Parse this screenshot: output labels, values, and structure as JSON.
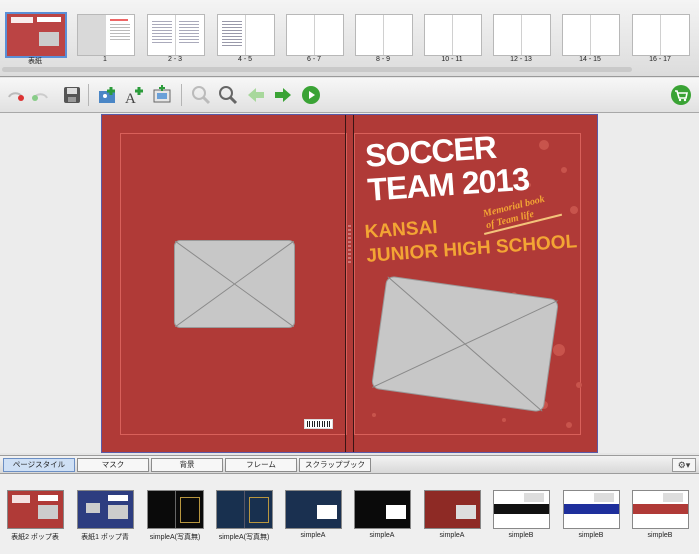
{
  "page_strip": {
    "thumbnails": [
      {
        "label": "表紙"
      },
      {
        "label": "1"
      },
      {
        "label": "2 - 3"
      },
      {
        "label": "4 - 5"
      },
      {
        "label": "6 - 7"
      },
      {
        "label": "8 - 9"
      },
      {
        "label": "10 - 11"
      },
      {
        "label": "12 - 13"
      },
      {
        "label": "14 - 15"
      },
      {
        "label": "16 - 17"
      }
    ],
    "selected_index": 0
  },
  "toolbar": {
    "icons": [
      "undo-icon",
      "redo-icon",
      "save-icon",
      "add-photo-icon",
      "add-text-icon",
      "add-frame-icon",
      "zoom-out-icon",
      "zoom-in-icon",
      "back-arrow-icon",
      "forward-arrow-icon",
      "play-icon",
      "cart-icon"
    ]
  },
  "cover": {
    "title_line1": "SOCCER",
    "title_line2": "TEAM 2013",
    "school_line1": "KANSAI",
    "school_line2": "JUNIOR HIGH SCHOOL",
    "subtitle_line1": "Memorial book",
    "subtitle_line2": "of Team life",
    "colors": {
      "cover": "#b03a37",
      "title": "#ffffff",
      "accent": "#f3a534"
    }
  },
  "tabs": [
    {
      "label": "ページスタイル",
      "active": true
    },
    {
      "label": "マスク",
      "active": false
    },
    {
      "label": "背景",
      "active": false
    },
    {
      "label": "フレーム",
      "active": false
    },
    {
      "label": "スクラップブック",
      "active": false
    }
  ],
  "styles": [
    {
      "label": "表紙2 ポップ表",
      "color": "#b03a37"
    },
    {
      "label": "表紙1 ポップ青",
      "color": "#2d3d80"
    },
    {
      "label": "simpleA(写真無)",
      "color": "#0a0a0a"
    },
    {
      "label": "simpleA(写真無)",
      "color": "#18304f"
    },
    {
      "label": "simpleA",
      "color": "#1a3050"
    },
    {
      "label": "simpleA",
      "color": "#0a0a0a"
    },
    {
      "label": "simpleA",
      "color": "#8e2a25"
    },
    {
      "label": "simpleB",
      "color": "#ffffff"
    },
    {
      "label": "simpleB",
      "color": "#ffffff"
    },
    {
      "label": "simpleB",
      "color": "#ffffff"
    }
  ]
}
